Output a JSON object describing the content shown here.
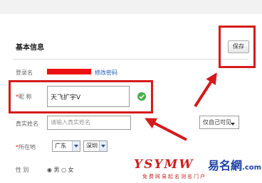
{
  "section": {
    "title": "基本信息"
  },
  "toolbar": {
    "save_label": "保存"
  },
  "form": {
    "login": {
      "label": "登录名",
      "change_password_link": "修改密码"
    },
    "nickname": {
      "required_mark": "*",
      "label": "昵 称",
      "value": "天飞扩宇V"
    },
    "real_name": {
      "label": "真实姓名",
      "placeholder": "请输入真实姓名",
      "visibility": "仅自己可见"
    },
    "location": {
      "required_mark": "*",
      "label": "所在地",
      "province": "广东",
      "city": "深圳"
    },
    "gender": {
      "label": "性 别",
      "options_text": "◉ 男 ○ 女"
    }
  },
  "watermark": {
    "left": "YSYMW",
    "right": "易名網",
    "right_domain": ".com",
    "subtitle": "免费网易起名测名门户"
  },
  "colors": {
    "highlight": "#d51a1a",
    "link": "#1a5fb4",
    "check": "#46b04a"
  },
  "icons": {
    "check": "check-icon",
    "dropdown": "chevron-down-icon"
  }
}
